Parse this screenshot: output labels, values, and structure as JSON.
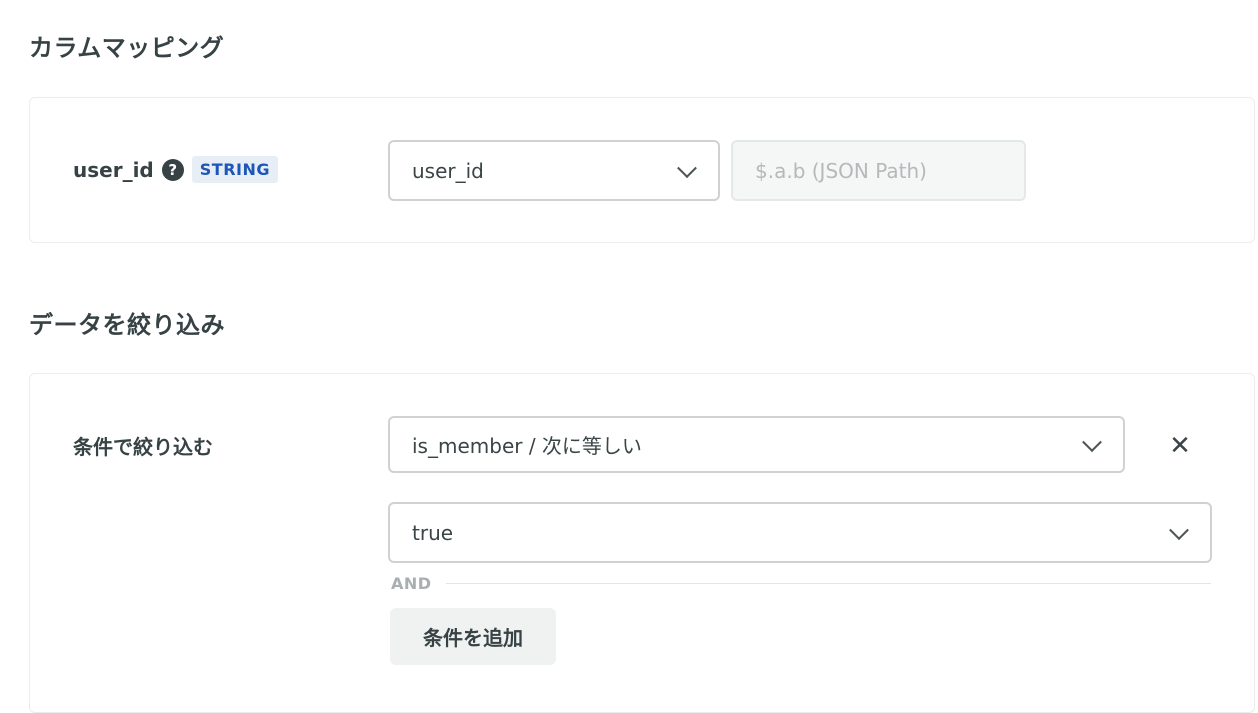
{
  "column_mapping": {
    "title": "カラムマッピング",
    "field": {
      "name": "user_id",
      "help": "?",
      "type": "STRING"
    },
    "column_select": {
      "value": "user_id"
    },
    "json_path": {
      "placeholder": "$.a.b (JSON Path)"
    }
  },
  "filter": {
    "title": "データを絞り込み",
    "label": "条件で絞り込む",
    "condition_select": {
      "value": "is_member / 次に等しい"
    },
    "value_select": {
      "value": "true"
    },
    "remove_icon": "✕",
    "and_label": "AND",
    "add_button": "条件を追加"
  }
}
